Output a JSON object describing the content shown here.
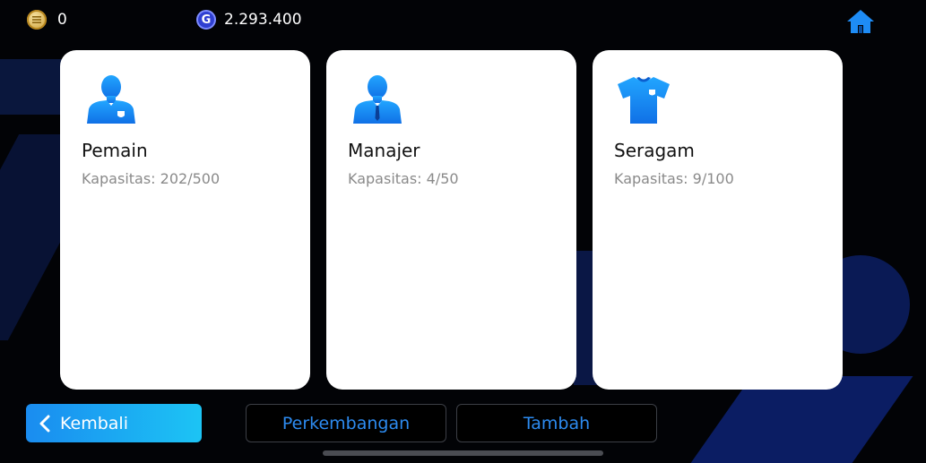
{
  "topbar": {
    "coins": "0",
    "gp": "2.293.400",
    "gp_icon_letter": "G"
  },
  "cards": [
    {
      "title": "Pemain",
      "capacity": "Kapasitas: 202/500",
      "icon": "player-icon"
    },
    {
      "title": "Manajer",
      "capacity": "Kapasitas: 4/50",
      "icon": "manager-icon"
    },
    {
      "title": "Seragam",
      "capacity": "Kapasitas: 9/100",
      "icon": "kit-icon"
    }
  ],
  "buttons": {
    "back": "Kembali",
    "development": "Perkembangan",
    "add": "Tambah"
  },
  "colors": {
    "accent": "#1a8cf0",
    "icon_blue": "#1e90ff",
    "background": "#020306"
  }
}
